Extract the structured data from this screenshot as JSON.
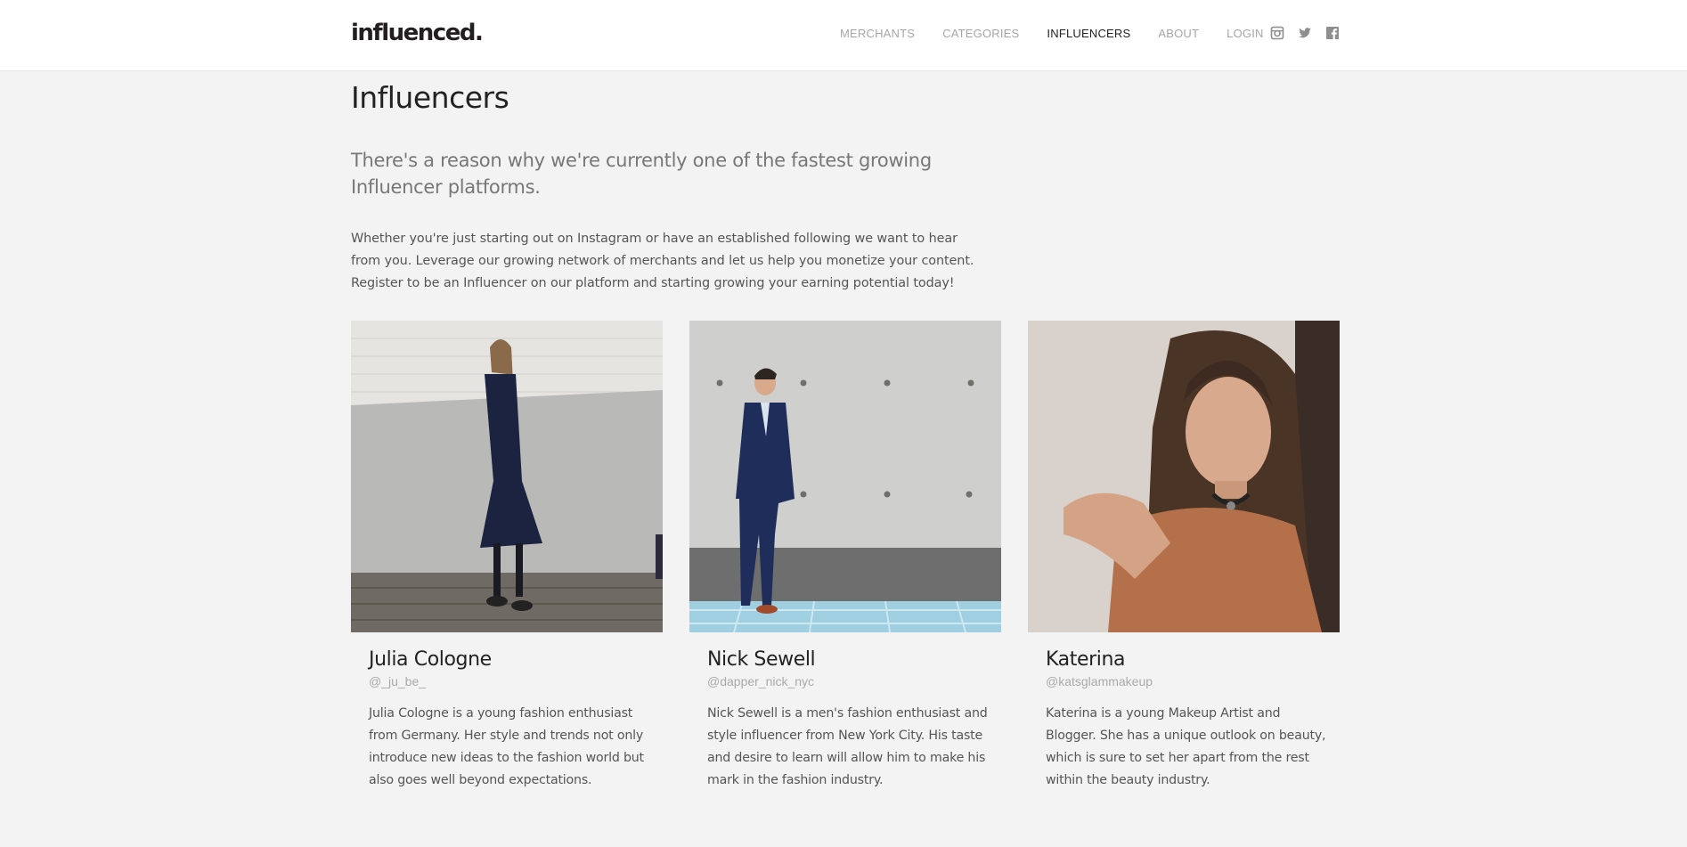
{
  "brand": {
    "logo_text": "influenced."
  },
  "nav": {
    "items": [
      {
        "label": "MERCHANTS",
        "active": false
      },
      {
        "label": "CATEGORIES",
        "active": false
      },
      {
        "label": "INFLUENCERS",
        "active": true
      },
      {
        "label": "ABOUT",
        "active": false
      },
      {
        "label": "LOGIN",
        "active": false
      }
    ]
  },
  "social": [
    "instagram-icon",
    "twitter-icon",
    "facebook-icon"
  ],
  "page": {
    "title": "Influencers",
    "lead": "There's a reason why we're currently one of the fastest growing Influencer platforms.",
    "intro": "Whether you're just starting out on Instagram or have an established following we want to hear from you. Leverage our growing network of merchants and let us help you monetize your content. Register to be an Influencer on our platform and starting growing your earning potential today!"
  },
  "influencers": [
    {
      "name": "Julia Cologne",
      "handle": "@_ju_be_",
      "bio": "Julia Cologne is a young fashion enthusiast from Germany. Her style and trends not only introduce new ideas to the fashion world but also goes well beyond expectations."
    },
    {
      "name": "Nick Sewell",
      "handle": "@dapper_nick_nyc",
      "bio": "Nick Sewell is a men's fashion enthusiast and style influencer from New York City. His taste and desire to learn will allow him to make his mark in the fashion industry."
    },
    {
      "name": "Katerina",
      "handle": "@katsglammakeup",
      "bio": "Katerina is a young Makeup Artist and Blogger. She has a unique outlook on beauty, which is sure to set her apart from the rest within the beauty industry."
    }
  ],
  "colors": {
    "header_bg": "#ffffff",
    "page_bg": "#f3f3f3",
    "nav_inactive": "#a6a6a6",
    "nav_active": "#222222"
  }
}
